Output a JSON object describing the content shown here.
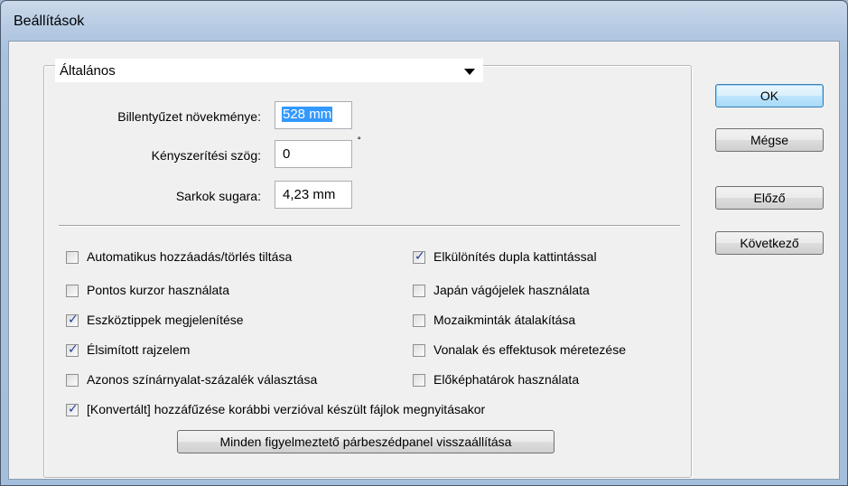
{
  "window": {
    "title": "Beállítások"
  },
  "section": {
    "selected": "Általános"
  },
  "fields": {
    "keyboard_increment": {
      "label": "Billentyűzet növekménye:",
      "value": "528 mm"
    },
    "constraint_angle": {
      "label": "Kényszerítési szög:",
      "value": "0",
      "unit": "˚"
    },
    "corner_radius": {
      "label": "Sarkok sugara:",
      "value": "4,23 mm"
    }
  },
  "checkboxes": [
    {
      "label": "Automatikus hozzáadás/törlés tiltása",
      "checked": false
    },
    {
      "label": "Elkülönítés dupla kattintással",
      "checked": true
    },
    {
      "label": "Pontos kurzor használata",
      "checked": false
    },
    {
      "label": "Japán vágójelek használata",
      "checked": false
    },
    {
      "label": "Eszköztippek megjelenítése",
      "checked": true
    },
    {
      "label": "Mozaikminták átalakítása",
      "checked": false
    },
    {
      "label": "Élsimított rajzelem",
      "checked": true
    },
    {
      "label": "Vonalak és effektusok méretezése",
      "checked": false
    },
    {
      "label": "Azonos színárnyalat-százalék választása",
      "checked": false
    },
    {
      "label": "Előképhatárok használata",
      "checked": false
    },
    {
      "label": "[Konvertált] hozzáfűzése korábbi verzióval készült fájlok megnyitásakor",
      "checked": true
    }
  ],
  "reset_button": {
    "label": "Minden figyelmeztető párbeszédpanel visszaállítása"
  },
  "buttons": {
    "ok": "OK",
    "cancel": "Mégse",
    "prev": "Előző",
    "next": "Következő"
  }
}
